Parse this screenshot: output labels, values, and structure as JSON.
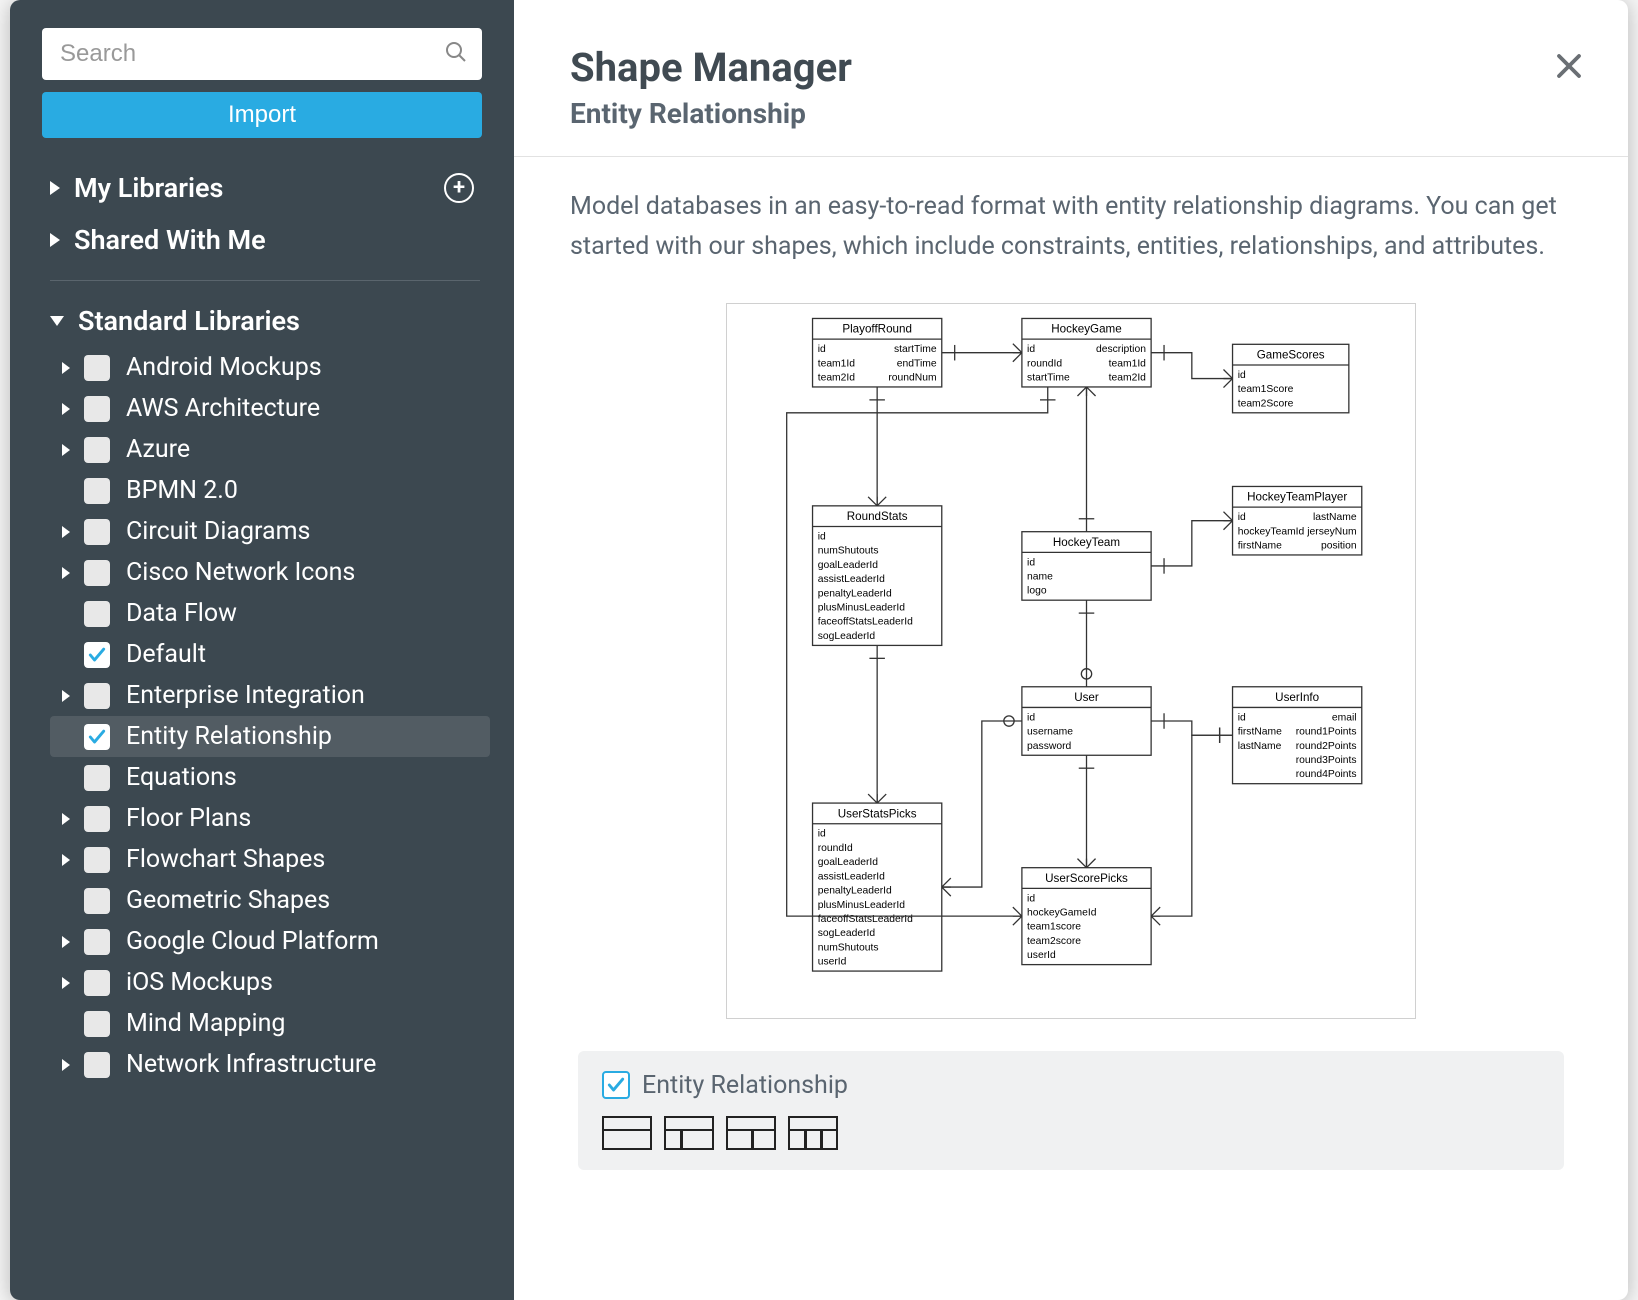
{
  "search": {
    "placeholder": "Search"
  },
  "import_label": "Import",
  "groups": {
    "my_libraries": "My Libraries",
    "shared_with_me": "Shared With Me",
    "standard": "Standard Libraries"
  },
  "libraries": [
    {
      "label": "Android Mockups",
      "caret": true,
      "checked": false,
      "selected": false
    },
    {
      "label": "AWS Architecture",
      "caret": true,
      "checked": false,
      "selected": false
    },
    {
      "label": "Azure",
      "caret": true,
      "checked": false,
      "selected": false
    },
    {
      "label": "BPMN 2.0",
      "caret": false,
      "checked": false,
      "selected": false
    },
    {
      "label": "Circuit Diagrams",
      "caret": true,
      "checked": false,
      "selected": false
    },
    {
      "label": "Cisco Network Icons",
      "caret": true,
      "checked": false,
      "selected": false
    },
    {
      "label": "Data Flow",
      "caret": false,
      "checked": false,
      "selected": false
    },
    {
      "label": "Default",
      "caret": false,
      "checked": true,
      "selected": false
    },
    {
      "label": "Enterprise Integration",
      "caret": true,
      "checked": false,
      "selected": false
    },
    {
      "label": "Entity Relationship",
      "caret": false,
      "checked": true,
      "selected": true
    },
    {
      "label": "Equations",
      "caret": false,
      "checked": false,
      "selected": false
    },
    {
      "label": "Floor Plans",
      "caret": true,
      "checked": false,
      "selected": false
    },
    {
      "label": "Flowchart Shapes",
      "caret": true,
      "checked": false,
      "selected": false
    },
    {
      "label": "Geometric Shapes",
      "caret": false,
      "checked": false,
      "selected": false
    },
    {
      "label": "Google Cloud Platform",
      "caret": true,
      "checked": false,
      "selected": false
    },
    {
      "label": "iOS Mockups",
      "caret": true,
      "checked": false,
      "selected": false
    },
    {
      "label": "Mind Mapping",
      "caret": false,
      "checked": false,
      "selected": false
    },
    {
      "label": "Network Infrastructure",
      "caret": true,
      "checked": false,
      "selected": false
    }
  ],
  "main": {
    "title": "Shape Manager",
    "subtitle": "Entity Relationship",
    "description": "Model databases in an easy-to-read format with entity relationship diagrams. You can get started with our shapes, which include constraints, entities, relationships, and attributes.",
    "panel_title": "Entity Relationship"
  },
  "erd": {
    "entities": [
      {
        "name": "PlayoffRound",
        "attrs_left": [
          "id",
          "team1Id",
          "team2Id"
        ],
        "attrs_right": [
          "startTime",
          "endTime",
          "roundNum"
        ]
      },
      {
        "name": "HockeyGame",
        "attrs_left": [
          "id",
          "roundId",
          "startTime"
        ],
        "attrs_right": [
          "description",
          "team1Id",
          "team2Id"
        ]
      },
      {
        "name": "GameScores",
        "attrs_left": [
          "id",
          "team1Score",
          "team2Score"
        ],
        "attrs_right": []
      },
      {
        "name": "RoundStats",
        "attrs_left": [
          "id",
          "numShutouts",
          "goalLeaderId",
          "assistLeaderId",
          "penaltyLeaderId",
          "plusMinusLeaderId",
          "faceoffStatsLeaderId",
          "sogLeaderId"
        ],
        "attrs_right": []
      },
      {
        "name": "HockeyTeam",
        "attrs_left": [
          "id",
          "name",
          "logo"
        ],
        "attrs_right": []
      },
      {
        "name": "HockeyTeamPlayer",
        "attrs_left": [
          "id",
          "hockeyTeamId",
          "firstName"
        ],
        "attrs_right": [
          "lastName",
          "jerseyNum",
          "position"
        ]
      },
      {
        "name": "User",
        "attrs_left": [
          "id",
          "username",
          "password"
        ],
        "attrs_right": []
      },
      {
        "name": "UserInfo",
        "attrs_left": [
          "id",
          "firstName",
          "lastName"
        ],
        "attrs_right": [
          "email",
          "round1Points",
          "round2Points",
          "round3Points",
          "round4Points"
        ]
      },
      {
        "name": "UserStatsPicks",
        "attrs_left": [
          "id",
          "roundId",
          "goalLeaderId",
          "assistLeaderId",
          "penaltyLeaderId",
          "plusMinusLeaderId",
          "faceoffStatsLeaderId",
          "sogLeaderId",
          "numShutouts",
          "userId"
        ],
        "attrs_right": []
      },
      {
        "name": "UserScorePicks",
        "attrs_left": [
          "id",
          "hockeyGameId",
          "team1score",
          "team2score",
          "userId"
        ],
        "attrs_right": []
      }
    ]
  }
}
